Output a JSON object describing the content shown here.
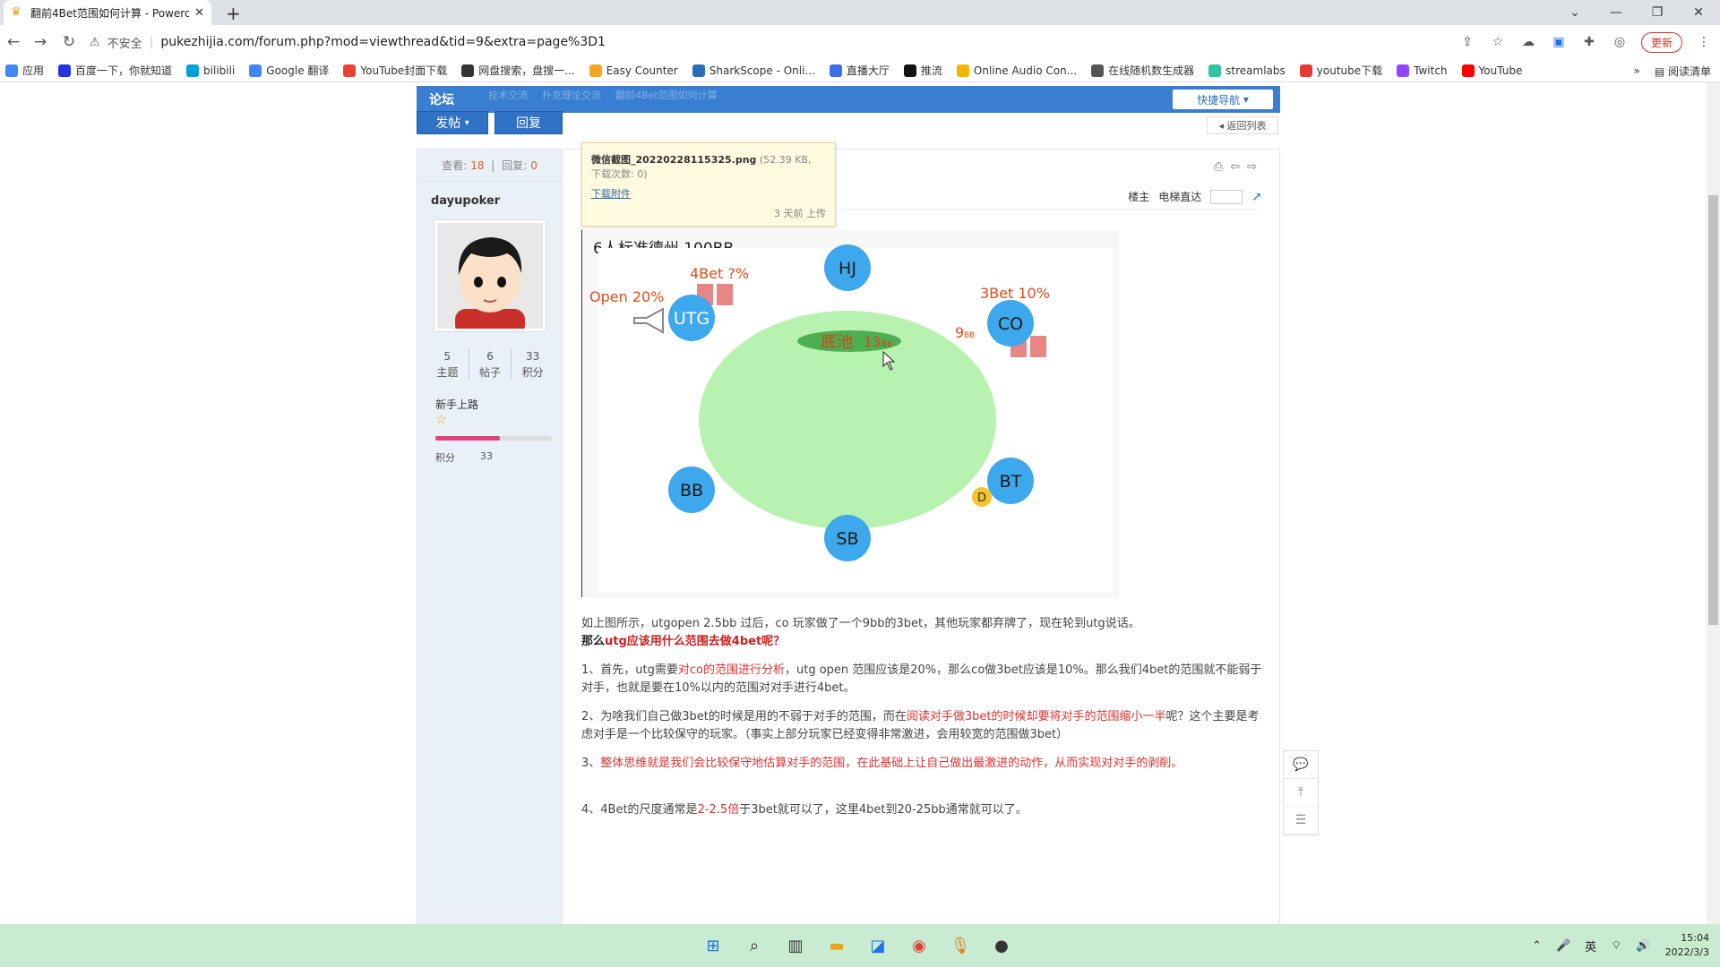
{
  "browser": {
    "tab_title": "翻前4Bet范围如何计算 - Powerc",
    "url": "pukezhijia.com/forum.php?mod=viewthread&tid=9&extra=page%3D1",
    "insecure_label": "不安全",
    "update_label": "更新"
  },
  "bookmarks": {
    "items": [
      {
        "label": "应用",
        "color": "#4285f4"
      },
      {
        "label": "百度一下，你就知道",
        "color": "#2932e1"
      },
      {
        "label": "bilibili",
        "color": "#00a1d6"
      },
      {
        "label": "Google 翻译",
        "color": "#4285f4"
      },
      {
        "label": "YouTube封面下载",
        "color": "#ea4335"
      },
      {
        "label": "网盘搜索，盘搜一...",
        "color": "#333333"
      },
      {
        "label": "Easy Counter",
        "color": "#f5a623"
      },
      {
        "label": "SharkScope - Onli...",
        "color": "#2a6ebb"
      },
      {
        "label": "直播大厅",
        "color": "#3e6ee8"
      },
      {
        "label": "推流",
        "color": "#111111"
      },
      {
        "label": "Online Audio Con...",
        "color": "#f4b400"
      },
      {
        "label": "在线随机数生成器",
        "color": "#555555"
      },
      {
        "label": "streamlabs",
        "color": "#31c3a2"
      },
      {
        "label": "youtube下载",
        "color": "#e53935"
      },
      {
        "label": "Twitch",
        "color": "#9146ff"
      },
      {
        "label": "YouTube",
        "color": "#ff0000"
      }
    ],
    "reading_list": "阅读清单"
  },
  "forum": {
    "logo": "论坛",
    "crumbs": [
      "技术交流",
      "扑克理论交流",
      "翻前4Bet范围如何计算"
    ],
    "quick_nav": "快捷导航",
    "post_button": "发帖",
    "reply_button": "回复",
    "back_to_list": "返回列表",
    "views_label": "查看:",
    "views": "18",
    "replies_label": "回复:",
    "replies": "0"
  },
  "user": {
    "name": "dayupoker",
    "topics": "5",
    "topics_label": "主题",
    "posts": "6",
    "posts_label": "帖子",
    "points": "33",
    "points_label": "积分",
    "rank": "新手上路",
    "progress": 0.55,
    "score_label": "积分",
    "score": "33"
  },
  "post": {
    "floor_owner": "楼主",
    "elevator": "电梯直达",
    "attachment": {
      "filename": "微信截图_20220228115325.png",
      "size": "(52.39 KB,",
      "downloads": "下载次数: 0)",
      "download_link": "下载附件",
      "uploaded": "3 天前 上传"
    },
    "figure": {
      "title": "6人标准德州 100BB",
      "open_label": "Open 20%",
      "fourbet_label": "4Bet ?%",
      "threebet_label": "3Bet 10%",
      "pot_label": "底池",
      "pot_value": "13",
      "pot_unit": "BB",
      "bet_value": "9",
      "bet_unit": "BB",
      "seats": [
        "HJ",
        "UTG",
        "CO",
        "BB",
        "BT",
        "SB"
      ],
      "dealer": "D"
    },
    "para1": "如上图所示，utgopen 2.5bb 过后，co 玩家做了一个9bb的3bet，其他玩家都弃牌了，现在轮到utg说话。",
    "para1_q_pre": "那么",
    "para1_q_red": "utg应该用什么范围去做4bet呢？",
    "p1_a": "1、首先，utg需要",
    "p1_b": "对co的范围进行分析",
    "p1_c": "，utg open 范围应该是20%，那么co做3bet应该是10%。那么我们4bet的范围就不能弱于对手，也就是要在10%以内的范围对对手进行4bet。",
    "p2_a": "2、为啥我们自己做3bet的时候是用的不弱于对手的范围，而在",
    "p2_b": "阅读对手做3bet的时候却要将对手的范围缩小一半",
    "p2_c": "呢？这个主要是考虑对手是一个比较保守的玩家。（事实上部分玩家已经变得非常激进，会用较宽的范围做3bet）",
    "p3_a": "3、",
    "p3_b": "整体思维就是我们会比较保守地估算对手的范围，在此基础上让自己做出最激进的动作，从而实现对对手的剥削。",
    "p4_a": "4、4Bet的尺度通常是",
    "p4_b": "2-2.5倍",
    "p4_c": "于3bet就可以了，这里4bet到20-25bb通常就可以了。"
  },
  "taskbar": {
    "time": "15:04",
    "date": "2022/3/3",
    "ime": "英"
  }
}
